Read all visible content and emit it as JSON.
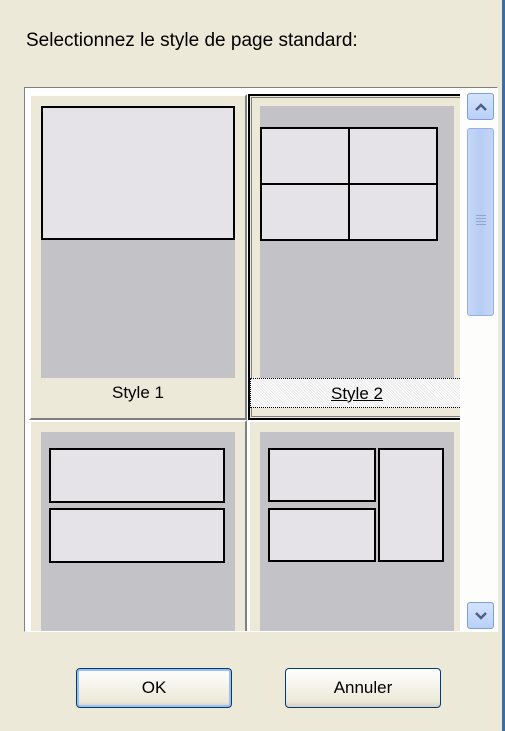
{
  "dialog": {
    "prompt": "Selectionnez le style de page standard:"
  },
  "styles": [
    {
      "label": "Style 1",
      "layout": "one-top",
      "selected": false
    },
    {
      "label": "Style 2",
      "layout": "four-grid",
      "selected": true
    },
    {
      "label": "",
      "layout": "two-stacked",
      "selected": false
    },
    {
      "label": "",
      "layout": "three-mixed",
      "selected": false
    }
  ],
  "buttons": {
    "ok_label": "OK",
    "cancel_label": "Annuler"
  },
  "scrollbar": {
    "up_icon": "scroll-up-arrow-icon",
    "down_icon": "scroll-down-arrow-icon"
  },
  "colors": {
    "dialog_bg": "#ece9d8",
    "page_bg": "#c3c2c6",
    "panel_fill": "#e6e3e8",
    "scroll_accent": "#b9d1f7"
  }
}
